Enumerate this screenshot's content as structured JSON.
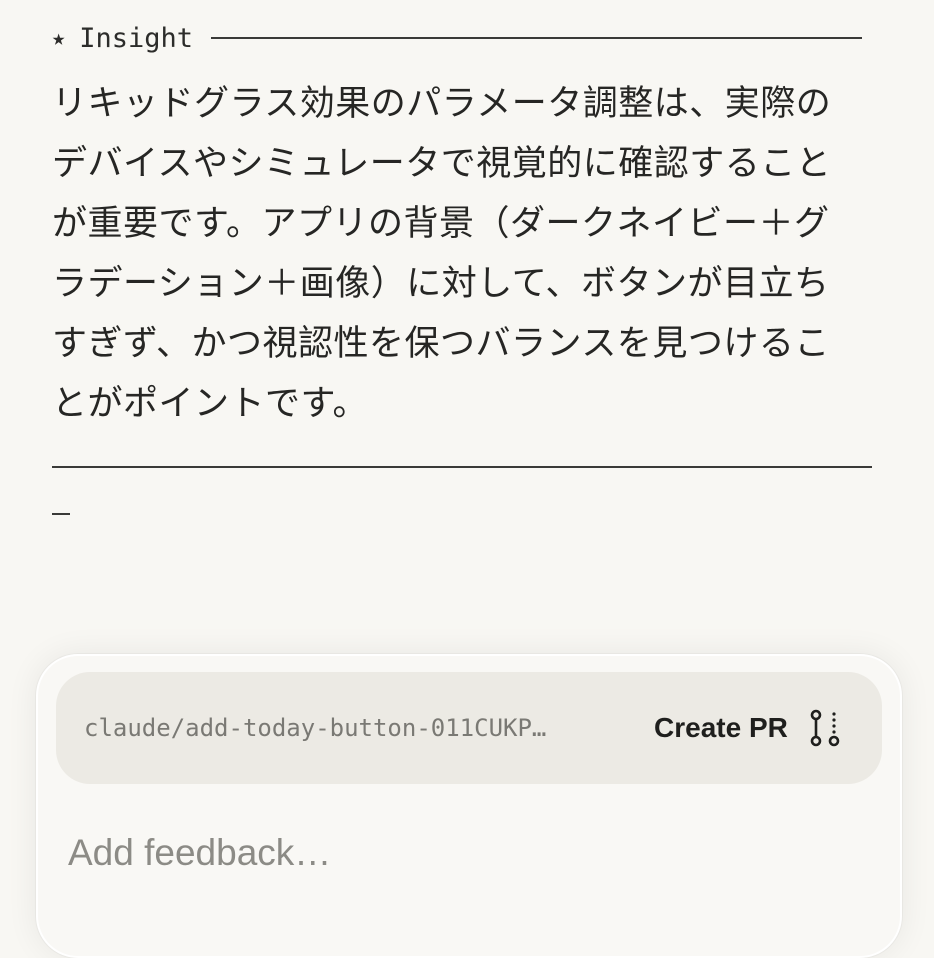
{
  "insight": {
    "star": "★",
    "title": "Insight",
    "lines": [
      "リキッドグラス効果のパラメータ調整は、実際の",
      "デバイスやシミュレータで視覚的に確認すること",
      "が重要です。アプリの背景（ダークネイビー＋グ",
      "ラデーション＋画像）に対して、ボタンが目立ち",
      "すぎず、かつ視認性を保つバランスを見つけるこ",
      "とがポイントです。"
    ]
  },
  "composer": {
    "branch_name": "claude/add-today-button-011CUKP…",
    "create_pr_label": "Create PR",
    "pr_icon": "git-pull-request-icon",
    "feedback_placeholder": "Add feedback…"
  },
  "colors": {
    "background": "#f8f7f3",
    "branch_bar": "#eceae4",
    "text": "#262624",
    "muted": "#8c8b86"
  }
}
